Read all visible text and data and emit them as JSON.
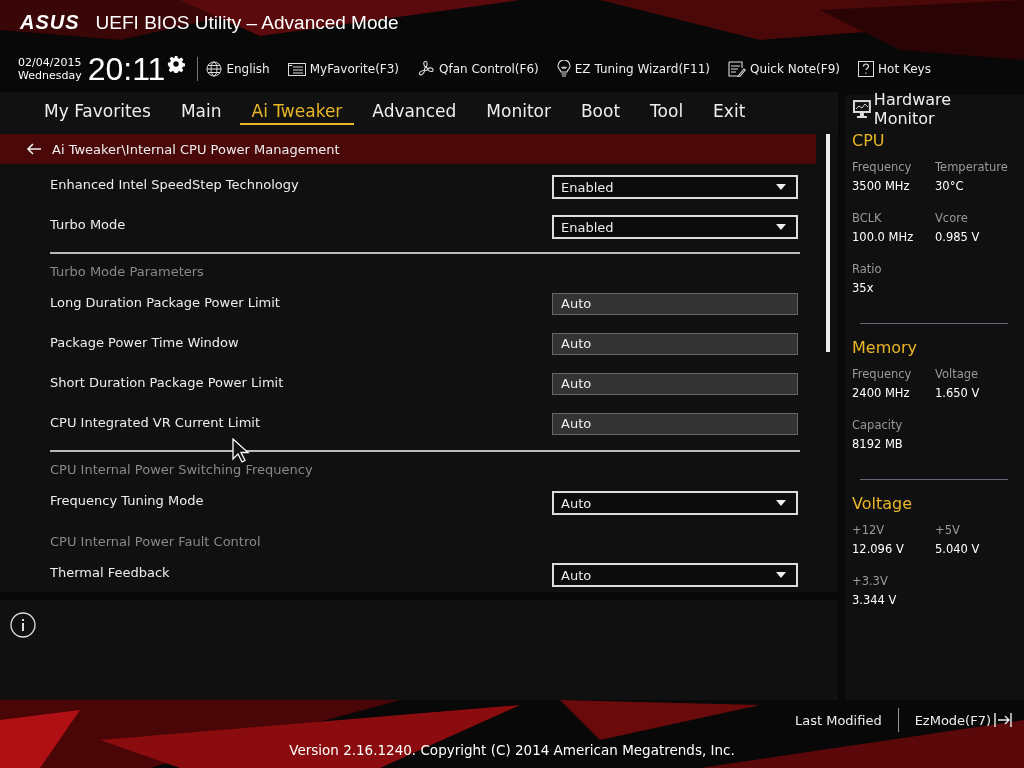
{
  "header": {
    "logo": "ASUS",
    "title": "UEFI BIOS Utility – Advanced Mode",
    "date": "02/04/2015",
    "weekday": "Wednesday",
    "time": "20:11"
  },
  "toolbar": [
    {
      "kind": "globe",
      "label": "English"
    },
    {
      "kind": "favorite",
      "label": "MyFavorite(F3)"
    },
    {
      "kind": "fan",
      "label": "Qfan Control(F6)"
    },
    {
      "kind": "bulb",
      "label": "EZ Tuning Wizard(F11)"
    },
    {
      "kind": "note",
      "label": "Quick Note(F9)"
    },
    {
      "kind": "help",
      "label": "Hot Keys"
    }
  ],
  "tabs": [
    {
      "label": "My Favorites",
      "selected": false
    },
    {
      "label": "Main",
      "selected": false
    },
    {
      "label": "Ai Tweaker",
      "selected": true
    },
    {
      "label": "Advanced",
      "selected": false
    },
    {
      "label": "Monitor",
      "selected": false
    },
    {
      "label": "Boot",
      "selected": false
    },
    {
      "label": "Tool",
      "selected": false
    },
    {
      "label": "Exit",
      "selected": false
    }
  ],
  "breadcrumb": "Ai Tweaker\\Internal CPU Power Management",
  "settings": [
    {
      "kind": "dropdown",
      "label": "Enhanced Intel SpeedStep Technology",
      "value": "Enabled"
    },
    {
      "kind": "dropdown",
      "label": "Turbo Mode",
      "value": "Enabled"
    },
    {
      "kind": "divider"
    },
    {
      "kind": "section",
      "label": "Turbo Mode Parameters"
    },
    {
      "kind": "field",
      "label": "Long Duration Package Power Limit",
      "value": "Auto"
    },
    {
      "kind": "field",
      "label": "Package Power Time Window",
      "value": "Auto"
    },
    {
      "kind": "field",
      "label": "Short Duration Package Power Limit",
      "value": "Auto"
    },
    {
      "kind": "field",
      "label": "CPU Integrated VR Current Limit",
      "value": "Auto"
    },
    {
      "kind": "divider"
    },
    {
      "kind": "section",
      "label": "CPU Internal Power Switching Frequency"
    },
    {
      "kind": "dropdown",
      "label": "Frequency Tuning Mode",
      "value": "Auto"
    },
    {
      "kind": "section",
      "label": "CPU Internal Power Fault Control"
    },
    {
      "kind": "dropdown",
      "label": "Thermal Feedback",
      "value": "Auto"
    }
  ],
  "hardware_monitor": {
    "title": "Hardware Monitor",
    "groups": [
      {
        "title": "CPU",
        "items": [
          {
            "label": "Frequency",
            "value": "3500 MHz"
          },
          {
            "label": "Temperature",
            "value": "30°C"
          },
          {
            "label": "BCLK",
            "value": "100.0 MHz"
          },
          {
            "label": "Vcore",
            "value": "0.985 V"
          },
          {
            "label": "Ratio",
            "value": "35x"
          }
        ]
      },
      {
        "title": "Memory",
        "items": [
          {
            "label": "Frequency",
            "value": "2400 MHz"
          },
          {
            "label": "Voltage",
            "value": "1.650 V"
          },
          {
            "label": "Capacity",
            "value": "8192 MB"
          }
        ]
      },
      {
        "title": "Voltage",
        "items": [
          {
            "label": "+12V",
            "value": "12.096 V"
          },
          {
            "label": "+5V",
            "value": "5.040 V"
          },
          {
            "label": "+3.3V",
            "value": "3.344 V"
          }
        ]
      }
    ]
  },
  "footer": {
    "last_modified": "Last Modified",
    "ez_mode": "EzMode(F7)",
    "copyright": "Version 2.16.1240. Copyright (C) 2014 American Megatrends, Inc."
  }
}
